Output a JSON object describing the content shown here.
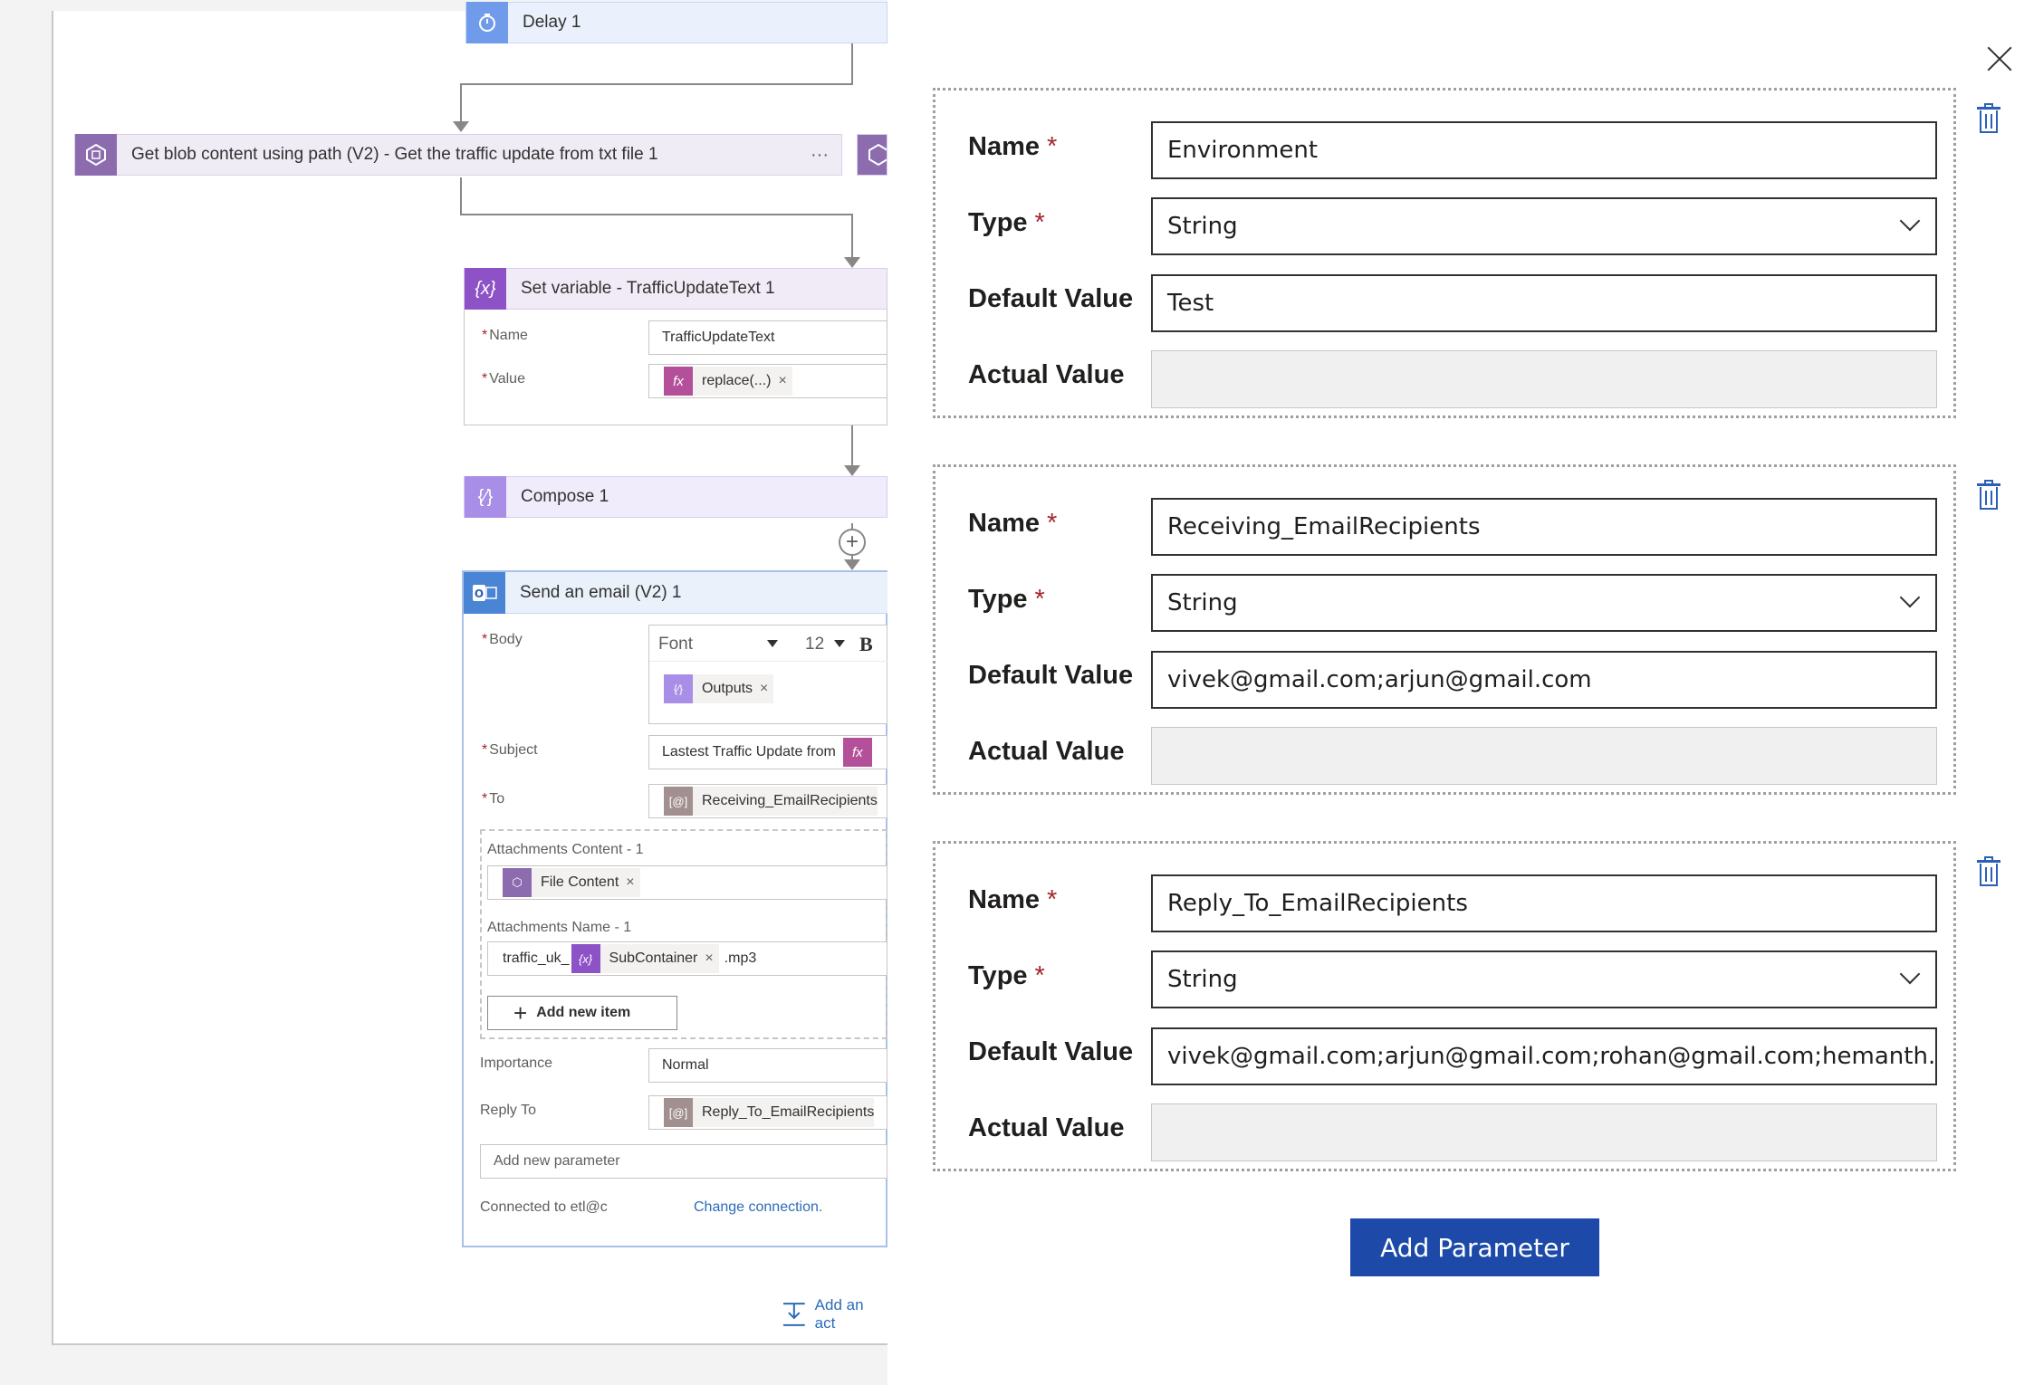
{
  "canvas": {
    "delay": {
      "title": "Delay 1"
    },
    "blob": {
      "title": "Get blob content using path (V2) - Get the traffic update from txt file 1",
      "more": "···"
    },
    "setvar": {
      "title": "Set variable - TrafficUpdateText 1",
      "name_label": "Name",
      "name_value": "TrafficUpdateText",
      "value_label": "Value",
      "value_token": "replace(...)",
      "fx_icon": "fx"
    },
    "compose": {
      "title": "Compose 1"
    },
    "email": {
      "title": "Send an email (V2) 1",
      "body_label": "Body",
      "font_select": "Font",
      "size_select": "12",
      "bold": "B",
      "outputs_token": "Outputs",
      "subject_label": "Subject",
      "subject_value": "Lastest Traffic Update from",
      "to_label": "To",
      "to_token": "Receiving_EmailRecipients",
      "attach_content_label": "Attachments Content - 1",
      "file_content_token": "File Content",
      "attach_name_label": "Attachments Name - 1",
      "attach_name_prefix": "traffic_uk_",
      "subcontainer_token": "SubContainer",
      "attach_name_suffix": ".mp3",
      "add_new_item": "Add new item",
      "importance_label": "Importance",
      "importance_value": "Normal",
      "replyto_label": "Reply To",
      "replyto_token": "Reply_To_EmailRecipients",
      "add_param_placeholder": "Add new parameter",
      "connected_to": "Connected to etl@c",
      "change_connection": "Change connection."
    },
    "add_action": "Add an act",
    "remove_x": "×",
    "required_star": "*"
  },
  "panel": {
    "labels": {
      "name": "Name",
      "type": "Type",
      "default_value": "Default Value",
      "actual_value": "Actual Value",
      "required": "*"
    },
    "parameters": [
      {
        "name": "Environment",
        "type": "String",
        "default_value": "Test",
        "actual_value": ""
      },
      {
        "name": "Receiving_EmailRecipients",
        "type": "String",
        "default_value": "vivek@gmail.com;arjun@gmail.com",
        "actual_value": ""
      },
      {
        "name": "Reply_To_EmailRecipients",
        "type": "String",
        "default_value": "vivek@gmail.com;arjun@gmail.com;rohan@gmail.com;hemanth...",
        "actual_value": ""
      }
    ],
    "add_parameter_button": "Add Parameter"
  },
  "colors": {
    "accent": "#1d4aa8",
    "delay_icon": "#6f9bea",
    "blob_icon": "#8c6cae",
    "variable_icon": "#8d52c6",
    "compose_icon": "#a88ee6",
    "outlook_icon": "#4a84d4",
    "expression_icon": "#b4509a",
    "param_token_icon": "#a28f8f"
  }
}
